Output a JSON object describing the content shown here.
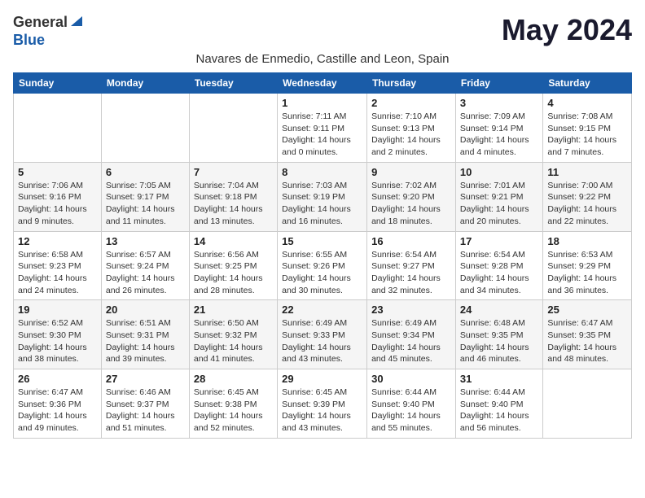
{
  "header": {
    "logo_general": "General",
    "logo_blue": "Blue",
    "month_title": "May 2024",
    "subtitle": "Navares de Enmedio, Castille and Leon, Spain"
  },
  "weekdays": [
    "Sunday",
    "Monday",
    "Tuesday",
    "Wednesday",
    "Thursday",
    "Friday",
    "Saturday"
  ],
  "weeks": [
    [
      {
        "day": "",
        "info": ""
      },
      {
        "day": "",
        "info": ""
      },
      {
        "day": "",
        "info": ""
      },
      {
        "day": "1",
        "info": "Sunrise: 7:11 AM\nSunset: 9:11 PM\nDaylight: 14 hours\nand 0 minutes."
      },
      {
        "day": "2",
        "info": "Sunrise: 7:10 AM\nSunset: 9:13 PM\nDaylight: 14 hours\nand 2 minutes."
      },
      {
        "day": "3",
        "info": "Sunrise: 7:09 AM\nSunset: 9:14 PM\nDaylight: 14 hours\nand 4 minutes."
      },
      {
        "day": "4",
        "info": "Sunrise: 7:08 AM\nSunset: 9:15 PM\nDaylight: 14 hours\nand 7 minutes."
      }
    ],
    [
      {
        "day": "5",
        "info": "Sunrise: 7:06 AM\nSunset: 9:16 PM\nDaylight: 14 hours\nand 9 minutes."
      },
      {
        "day": "6",
        "info": "Sunrise: 7:05 AM\nSunset: 9:17 PM\nDaylight: 14 hours\nand 11 minutes."
      },
      {
        "day": "7",
        "info": "Sunrise: 7:04 AM\nSunset: 9:18 PM\nDaylight: 14 hours\nand 13 minutes."
      },
      {
        "day": "8",
        "info": "Sunrise: 7:03 AM\nSunset: 9:19 PM\nDaylight: 14 hours\nand 16 minutes."
      },
      {
        "day": "9",
        "info": "Sunrise: 7:02 AM\nSunset: 9:20 PM\nDaylight: 14 hours\nand 18 minutes."
      },
      {
        "day": "10",
        "info": "Sunrise: 7:01 AM\nSunset: 9:21 PM\nDaylight: 14 hours\nand 20 minutes."
      },
      {
        "day": "11",
        "info": "Sunrise: 7:00 AM\nSunset: 9:22 PM\nDaylight: 14 hours\nand 22 minutes."
      }
    ],
    [
      {
        "day": "12",
        "info": "Sunrise: 6:58 AM\nSunset: 9:23 PM\nDaylight: 14 hours\nand 24 minutes."
      },
      {
        "day": "13",
        "info": "Sunrise: 6:57 AM\nSunset: 9:24 PM\nDaylight: 14 hours\nand 26 minutes."
      },
      {
        "day": "14",
        "info": "Sunrise: 6:56 AM\nSunset: 9:25 PM\nDaylight: 14 hours\nand 28 minutes."
      },
      {
        "day": "15",
        "info": "Sunrise: 6:55 AM\nSunset: 9:26 PM\nDaylight: 14 hours\nand 30 minutes."
      },
      {
        "day": "16",
        "info": "Sunrise: 6:54 AM\nSunset: 9:27 PM\nDaylight: 14 hours\nand 32 minutes."
      },
      {
        "day": "17",
        "info": "Sunrise: 6:54 AM\nSunset: 9:28 PM\nDaylight: 14 hours\nand 34 minutes."
      },
      {
        "day": "18",
        "info": "Sunrise: 6:53 AM\nSunset: 9:29 PM\nDaylight: 14 hours\nand 36 minutes."
      }
    ],
    [
      {
        "day": "19",
        "info": "Sunrise: 6:52 AM\nSunset: 9:30 PM\nDaylight: 14 hours\nand 38 minutes."
      },
      {
        "day": "20",
        "info": "Sunrise: 6:51 AM\nSunset: 9:31 PM\nDaylight: 14 hours\nand 39 minutes."
      },
      {
        "day": "21",
        "info": "Sunrise: 6:50 AM\nSunset: 9:32 PM\nDaylight: 14 hours\nand 41 minutes."
      },
      {
        "day": "22",
        "info": "Sunrise: 6:49 AM\nSunset: 9:33 PM\nDaylight: 14 hours\nand 43 minutes."
      },
      {
        "day": "23",
        "info": "Sunrise: 6:49 AM\nSunset: 9:34 PM\nDaylight: 14 hours\nand 45 minutes."
      },
      {
        "day": "24",
        "info": "Sunrise: 6:48 AM\nSunset: 9:35 PM\nDaylight: 14 hours\nand 46 minutes."
      },
      {
        "day": "25",
        "info": "Sunrise: 6:47 AM\nSunset: 9:35 PM\nDaylight: 14 hours\nand 48 minutes."
      }
    ],
    [
      {
        "day": "26",
        "info": "Sunrise: 6:47 AM\nSunset: 9:36 PM\nDaylight: 14 hours\nand 49 minutes."
      },
      {
        "day": "27",
        "info": "Sunrise: 6:46 AM\nSunset: 9:37 PM\nDaylight: 14 hours\nand 51 minutes."
      },
      {
        "day": "28",
        "info": "Sunrise: 6:45 AM\nSunset: 9:38 PM\nDaylight: 14 hours\nand 52 minutes."
      },
      {
        "day": "29",
        "info": "Sunrise: 6:45 AM\nSunset: 9:39 PM\nDaylight: 14 hours\nand 43 minutes."
      },
      {
        "day": "30",
        "info": "Sunrise: 6:44 AM\nSunset: 9:40 PM\nDaylight: 14 hours\nand 55 minutes."
      },
      {
        "day": "31",
        "info": "Sunrise: 6:44 AM\nSunset: 9:40 PM\nDaylight: 14 hours\nand 56 minutes."
      },
      {
        "day": "",
        "info": ""
      }
    ]
  ]
}
